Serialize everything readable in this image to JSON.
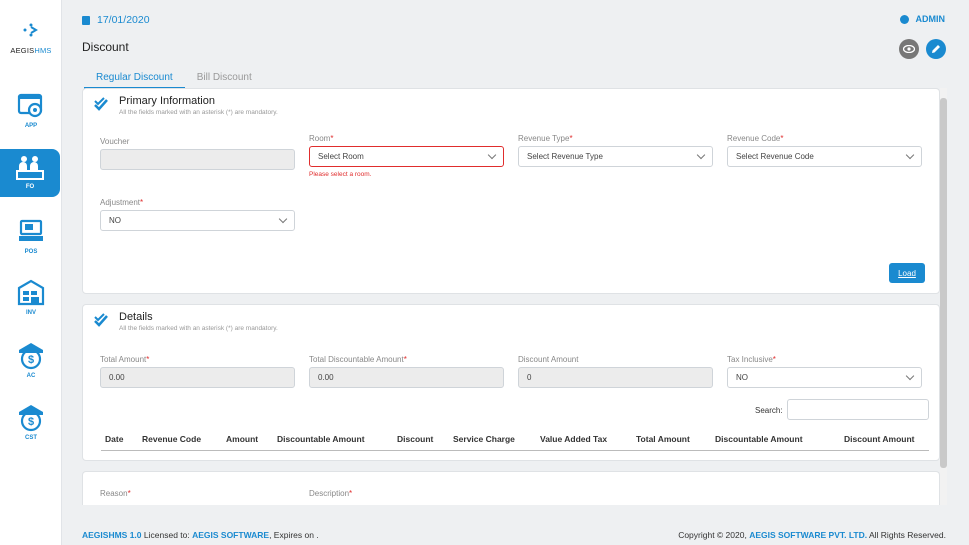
{
  "brand": {
    "name_prefix": "AEGIS",
    "name_suffix": "HMS",
    "accent": "#1a8ad0",
    "error": "#e02d2d"
  },
  "sidebar": {
    "items": [
      {
        "label": "APP",
        "icon": "app-settings-icon"
      },
      {
        "label": "FO",
        "icon": "front-office-icon",
        "active": true
      },
      {
        "label": "POS",
        "icon": "pos-terminal-icon"
      },
      {
        "label": "INV",
        "icon": "inventory-icon"
      },
      {
        "label": "AC",
        "icon": "accounts-dollar-icon"
      },
      {
        "label": "CST",
        "icon": "cost-dollar-icon"
      }
    ]
  },
  "header": {
    "date": "17/01/2020",
    "user": "ADMIN",
    "page_title": "Discount"
  },
  "tabs": [
    {
      "label": "Regular Discount",
      "active": true
    },
    {
      "label": "Bill Discount",
      "active": false
    }
  ],
  "primary": {
    "title": "Primary Information",
    "subtitle": "All the fields marked with an asterisk (*) are mandatory.",
    "fields": {
      "voucher": {
        "label": "Voucher",
        "value": ""
      },
      "room": {
        "label": "Room",
        "value": "Select Room",
        "error": "Please select a room."
      },
      "revenue_type": {
        "label": "Revenue Type",
        "value": "Select Revenue Type"
      },
      "revenue_code": {
        "label": "Revenue Code",
        "value": "Select Revenue Code"
      },
      "adjustment": {
        "label": "Adjustment",
        "value": "NO"
      }
    },
    "load_label": "Load"
  },
  "details": {
    "title": "Details",
    "subtitle": "All the fields marked with an asterisk (*) are mandatory.",
    "fields": {
      "total_amount": {
        "label": "Total Amount",
        "value": "0.00"
      },
      "total_discountable": {
        "label": "Total Discountable Amount",
        "value": "0.00"
      },
      "discount_amount": {
        "label": "Discount Amount",
        "value": "0"
      },
      "tax_inclusive": {
        "label": "Tax Inclusive",
        "value": "NO"
      }
    },
    "search_label": "Search:",
    "columns": [
      "Date",
      "Revenue Code",
      "Amount",
      "Discountable Amount",
      "Discount",
      "Service Charge",
      "Value Added Tax",
      "Total Amount",
      "Discountable Amount",
      "Discount Amount"
    ]
  },
  "remarks": {
    "reason_label": "Reason",
    "description_label": "Description"
  },
  "footer": {
    "left_product": "AEGISHMS 1.0",
    "left_mid": " Licensed to: ",
    "left_company": "AEGIS SOFTWARE",
    "left_end": ", Expires on .",
    "right_start": "Copyright © 2020, ",
    "right_company": "AEGIS SOFTWARE PVT. LTD.",
    "right_end": " All Rights Reserved."
  }
}
